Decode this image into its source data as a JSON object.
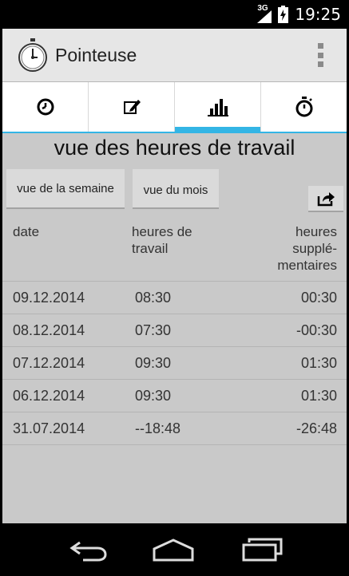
{
  "status": {
    "network": "3G",
    "time": "19:25"
  },
  "app": {
    "title": "Pointeuse"
  },
  "tabs": [
    {
      "icon": "clock-icon",
      "selected": false
    },
    {
      "icon": "edit-icon",
      "selected": false
    },
    {
      "icon": "bar-chart-icon",
      "selected": true
    },
    {
      "icon": "stopwatch-icon",
      "selected": false
    }
  ],
  "main": {
    "title": "vue des heures de travail",
    "week_button": "vue de la semaine",
    "month_button": "vue du mois",
    "share_icon": "share-icon"
  },
  "table": {
    "headers": {
      "date": "date",
      "hours_line1": "heures de",
      "hours_line2": "travail",
      "over_line1": "heures",
      "over_line2": "supplé-",
      "over_line3": "mentaires"
    },
    "rows": [
      {
        "date": "09.12.2014",
        "hours": "08:30",
        "overtime": "00:30"
      },
      {
        "date": "08.12.2014",
        "hours": "07:30",
        "overtime": "-00:30"
      },
      {
        "date": "07.12.2014",
        "hours": "09:30",
        "overtime": "01:30"
      },
      {
        "date": "06.12.2014",
        "hours": "09:30",
        "overtime": "01:30"
      },
      {
        "date": "31.07.2014",
        "hours": "--18:48",
        "overtime": "-26:48"
      }
    ]
  },
  "colors": {
    "accent": "#33b5e5",
    "background": "#c9c9c9",
    "actionbar": "#e6e6e6"
  }
}
